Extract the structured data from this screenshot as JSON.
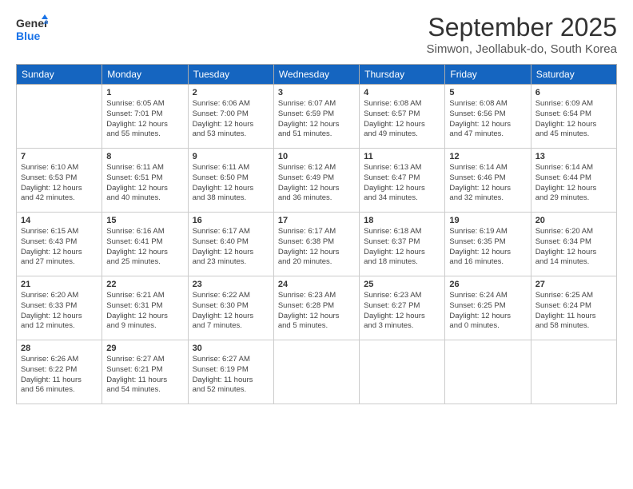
{
  "header": {
    "logo_general": "General",
    "logo_blue": "Blue",
    "month": "September 2025",
    "location": "Simwon, Jeollabuk-do, South Korea"
  },
  "days_of_week": [
    "Sunday",
    "Monday",
    "Tuesday",
    "Wednesday",
    "Thursday",
    "Friday",
    "Saturday"
  ],
  "weeks": [
    [
      {
        "day": "",
        "info": ""
      },
      {
        "day": "1",
        "info": "Sunrise: 6:05 AM\nSunset: 7:01 PM\nDaylight: 12 hours\nand 55 minutes."
      },
      {
        "day": "2",
        "info": "Sunrise: 6:06 AM\nSunset: 7:00 PM\nDaylight: 12 hours\nand 53 minutes."
      },
      {
        "day": "3",
        "info": "Sunrise: 6:07 AM\nSunset: 6:59 PM\nDaylight: 12 hours\nand 51 minutes."
      },
      {
        "day": "4",
        "info": "Sunrise: 6:08 AM\nSunset: 6:57 PM\nDaylight: 12 hours\nand 49 minutes."
      },
      {
        "day": "5",
        "info": "Sunrise: 6:08 AM\nSunset: 6:56 PM\nDaylight: 12 hours\nand 47 minutes."
      },
      {
        "day": "6",
        "info": "Sunrise: 6:09 AM\nSunset: 6:54 PM\nDaylight: 12 hours\nand 45 minutes."
      }
    ],
    [
      {
        "day": "7",
        "info": "Sunrise: 6:10 AM\nSunset: 6:53 PM\nDaylight: 12 hours\nand 42 minutes."
      },
      {
        "day": "8",
        "info": "Sunrise: 6:11 AM\nSunset: 6:51 PM\nDaylight: 12 hours\nand 40 minutes."
      },
      {
        "day": "9",
        "info": "Sunrise: 6:11 AM\nSunset: 6:50 PM\nDaylight: 12 hours\nand 38 minutes."
      },
      {
        "day": "10",
        "info": "Sunrise: 6:12 AM\nSunset: 6:49 PM\nDaylight: 12 hours\nand 36 minutes."
      },
      {
        "day": "11",
        "info": "Sunrise: 6:13 AM\nSunset: 6:47 PM\nDaylight: 12 hours\nand 34 minutes."
      },
      {
        "day": "12",
        "info": "Sunrise: 6:14 AM\nSunset: 6:46 PM\nDaylight: 12 hours\nand 32 minutes."
      },
      {
        "day": "13",
        "info": "Sunrise: 6:14 AM\nSunset: 6:44 PM\nDaylight: 12 hours\nand 29 minutes."
      }
    ],
    [
      {
        "day": "14",
        "info": "Sunrise: 6:15 AM\nSunset: 6:43 PM\nDaylight: 12 hours\nand 27 minutes."
      },
      {
        "day": "15",
        "info": "Sunrise: 6:16 AM\nSunset: 6:41 PM\nDaylight: 12 hours\nand 25 minutes."
      },
      {
        "day": "16",
        "info": "Sunrise: 6:17 AM\nSunset: 6:40 PM\nDaylight: 12 hours\nand 23 minutes."
      },
      {
        "day": "17",
        "info": "Sunrise: 6:17 AM\nSunset: 6:38 PM\nDaylight: 12 hours\nand 20 minutes."
      },
      {
        "day": "18",
        "info": "Sunrise: 6:18 AM\nSunset: 6:37 PM\nDaylight: 12 hours\nand 18 minutes."
      },
      {
        "day": "19",
        "info": "Sunrise: 6:19 AM\nSunset: 6:35 PM\nDaylight: 12 hours\nand 16 minutes."
      },
      {
        "day": "20",
        "info": "Sunrise: 6:20 AM\nSunset: 6:34 PM\nDaylight: 12 hours\nand 14 minutes."
      }
    ],
    [
      {
        "day": "21",
        "info": "Sunrise: 6:20 AM\nSunset: 6:33 PM\nDaylight: 12 hours\nand 12 minutes."
      },
      {
        "day": "22",
        "info": "Sunrise: 6:21 AM\nSunset: 6:31 PM\nDaylight: 12 hours\nand 9 minutes."
      },
      {
        "day": "23",
        "info": "Sunrise: 6:22 AM\nSunset: 6:30 PM\nDaylight: 12 hours\nand 7 minutes."
      },
      {
        "day": "24",
        "info": "Sunrise: 6:23 AM\nSunset: 6:28 PM\nDaylight: 12 hours\nand 5 minutes."
      },
      {
        "day": "25",
        "info": "Sunrise: 6:23 AM\nSunset: 6:27 PM\nDaylight: 12 hours\nand 3 minutes."
      },
      {
        "day": "26",
        "info": "Sunrise: 6:24 AM\nSunset: 6:25 PM\nDaylight: 12 hours\nand 0 minutes."
      },
      {
        "day": "27",
        "info": "Sunrise: 6:25 AM\nSunset: 6:24 PM\nDaylight: 11 hours\nand 58 minutes."
      }
    ],
    [
      {
        "day": "28",
        "info": "Sunrise: 6:26 AM\nSunset: 6:22 PM\nDaylight: 11 hours\nand 56 minutes."
      },
      {
        "day": "29",
        "info": "Sunrise: 6:27 AM\nSunset: 6:21 PM\nDaylight: 11 hours\nand 54 minutes."
      },
      {
        "day": "30",
        "info": "Sunrise: 6:27 AM\nSunset: 6:19 PM\nDaylight: 11 hours\nand 52 minutes."
      },
      {
        "day": "",
        "info": ""
      },
      {
        "day": "",
        "info": ""
      },
      {
        "day": "",
        "info": ""
      },
      {
        "day": "",
        "info": ""
      }
    ]
  ]
}
